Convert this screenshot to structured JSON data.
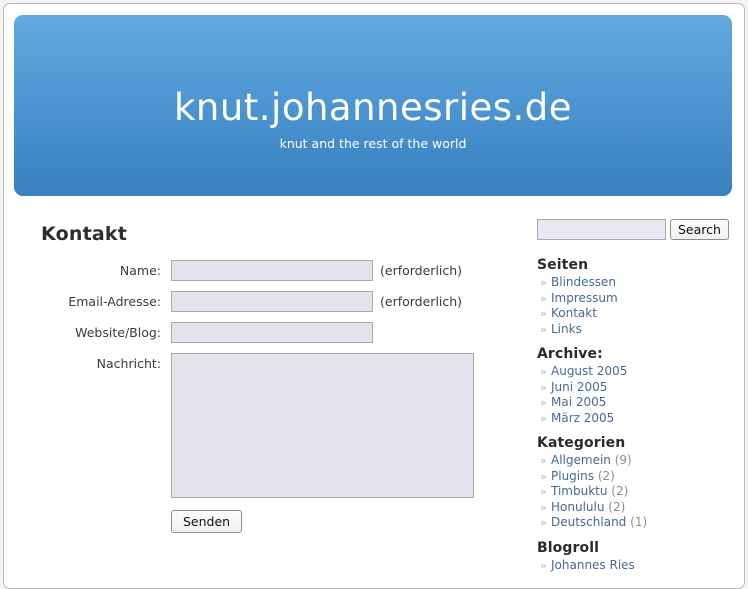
{
  "site": {
    "title": "knut.johannesries.de",
    "tagline": "knut and the rest of the world"
  },
  "main": {
    "page_title": "Kontakt",
    "form": {
      "name_label": "Name:",
      "name_value": "",
      "name_required_note": "(erforderlich)",
      "email_label": "Email-Adresse:",
      "email_value": "",
      "email_required_note": "(erforderlich)",
      "website_label": "Website/Blog:",
      "website_value": "",
      "message_label": "Nachricht:",
      "message_value": "",
      "submit_label": "Senden"
    }
  },
  "sidebar": {
    "search": {
      "value": "",
      "placeholder": "",
      "button_label": "Search"
    },
    "sections": [
      {
        "heading": "Seiten",
        "items": [
          {
            "label": "Blindessen",
            "count": ""
          },
          {
            "label": "Impressum",
            "count": ""
          },
          {
            "label": "Kontakt",
            "count": ""
          },
          {
            "label": "Links",
            "count": ""
          }
        ]
      },
      {
        "heading": "Archive:",
        "items": [
          {
            "label": "August 2005",
            "count": ""
          },
          {
            "label": "Juni 2005",
            "count": ""
          },
          {
            "label": "Mai 2005",
            "count": ""
          },
          {
            "label": "März 2005",
            "count": ""
          }
        ]
      },
      {
        "heading": "Kategorien",
        "items": [
          {
            "label": "Allgemein",
            "count": "(9)"
          },
          {
            "label": "Plugins",
            "count": "(2)"
          },
          {
            "label": "Timbuktu",
            "count": "(2)"
          },
          {
            "label": "Honululu",
            "count": "(2)"
          },
          {
            "label": "Deutschland",
            "count": "(1)"
          }
        ]
      },
      {
        "heading": "Blogroll",
        "items": [
          {
            "label": "Johannes Ries",
            "count": ""
          }
        ]
      }
    ],
    "bullet_glyph": "»"
  },
  "colors": {
    "header_gradient_top": "#64a9e0",
    "header_gradient_bottom": "#3a81bd",
    "link": "#46699a",
    "heading": "#2b2b2b",
    "input_fill": "#e3e3ec",
    "page_background": "#ffffff"
  }
}
